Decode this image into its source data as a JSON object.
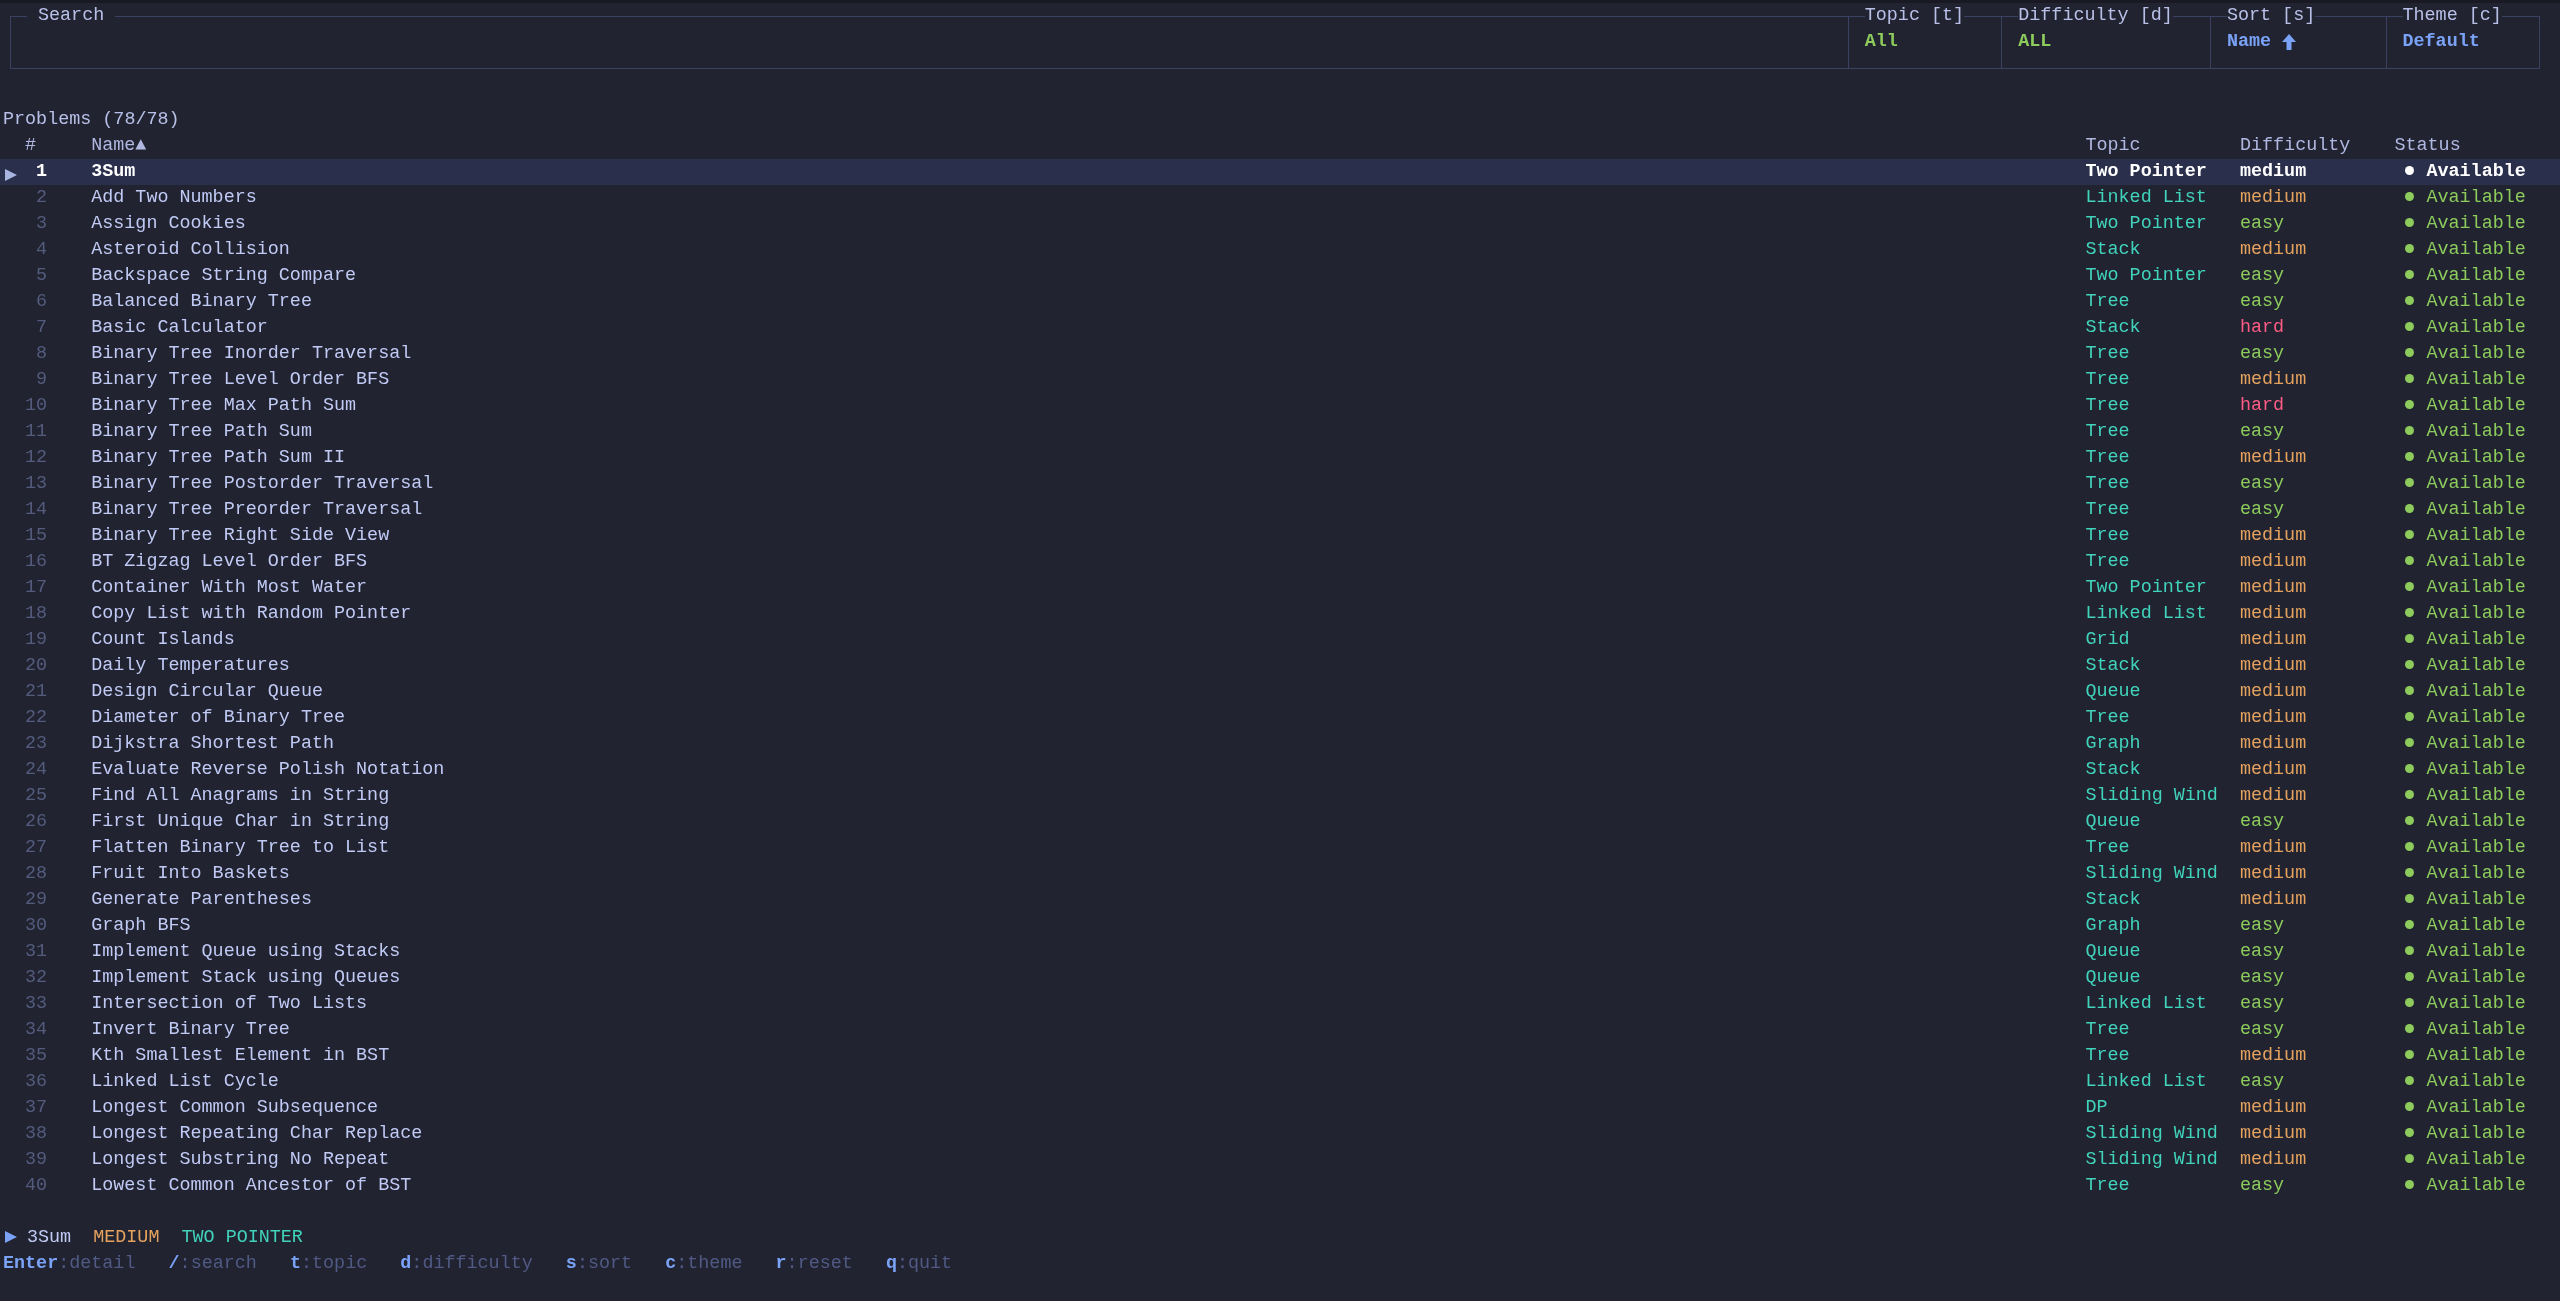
{
  "search": {
    "label": "Search"
  },
  "filters": [
    {
      "label": "Topic [t]",
      "value": "All",
      "kind": "filter"
    },
    {
      "label": "Difficulty [d]",
      "value": "ALL",
      "kind": "filter"
    },
    {
      "label": "Sort [s]",
      "value": "Name",
      "kind": "sort",
      "ascending": true
    },
    {
      "label": "Theme [c]",
      "value": "Default",
      "kind": "theme"
    }
  ],
  "problems": {
    "title": "Problems (78/78)",
    "columns": [
      "#",
      "Name▲",
      "Topic",
      "Difficulty",
      "Status"
    ],
    "rows": [
      {
        "number": "1",
        "name": "3Sum",
        "topic": "Two Pointer",
        "difficulty": {
          "label": "medium",
          "kind": "medium"
        },
        "status": "Available",
        "selected": true
      },
      {
        "number": "2",
        "name": "Add Two Numbers",
        "topic": "Linked List",
        "difficulty": {
          "label": "medium",
          "kind": "medium"
        },
        "status": "Available",
        "selected": false
      },
      {
        "number": "3",
        "name": "Assign Cookies",
        "topic": "Two Pointer",
        "difficulty": {
          "label": "easy",
          "kind": "easy"
        },
        "status": "Available",
        "selected": false
      },
      {
        "number": "4",
        "name": "Asteroid Collision",
        "topic": "Stack",
        "difficulty": {
          "label": "medium",
          "kind": "medium"
        },
        "status": "Available",
        "selected": false
      },
      {
        "number": "5",
        "name": "Backspace String Compare",
        "topic": "Two Pointer",
        "difficulty": {
          "label": "easy",
          "kind": "easy"
        },
        "status": "Available",
        "selected": false
      },
      {
        "number": "6",
        "name": "Balanced Binary Tree",
        "topic": "Tree",
        "difficulty": {
          "label": "easy",
          "kind": "easy"
        },
        "status": "Available",
        "selected": false
      },
      {
        "number": "7",
        "name": "Basic Calculator",
        "topic": "Stack",
        "difficulty": {
          "label": "hard",
          "kind": "hard"
        },
        "status": "Available",
        "selected": false
      },
      {
        "number": "8",
        "name": "Binary Tree Inorder Traversal",
        "topic": "Tree",
        "difficulty": {
          "label": "easy",
          "kind": "easy"
        },
        "status": "Available",
        "selected": false
      },
      {
        "number": "9",
        "name": "Binary Tree Level Order BFS",
        "topic": "Tree",
        "difficulty": {
          "label": "medium",
          "kind": "medium"
        },
        "status": "Available",
        "selected": false
      },
      {
        "number": "10",
        "name": "Binary Tree Max Path Sum",
        "topic": "Tree",
        "difficulty": {
          "label": "hard",
          "kind": "hard"
        },
        "status": "Available",
        "selected": false
      },
      {
        "number": "11",
        "name": "Binary Tree Path Sum",
        "topic": "Tree",
        "difficulty": {
          "label": "easy",
          "kind": "easy"
        },
        "status": "Available",
        "selected": false
      },
      {
        "number": "12",
        "name": "Binary Tree Path Sum II",
        "topic": "Tree",
        "difficulty": {
          "label": "medium",
          "kind": "medium"
        },
        "status": "Available",
        "selected": false
      },
      {
        "number": "13",
        "name": "Binary Tree Postorder Traversal",
        "topic": "Tree",
        "difficulty": {
          "label": "easy",
          "kind": "easy"
        },
        "status": "Available",
        "selected": false
      },
      {
        "number": "14",
        "name": "Binary Tree Preorder Traversal",
        "topic": "Tree",
        "difficulty": {
          "label": "easy",
          "kind": "easy"
        },
        "status": "Available",
        "selected": false
      },
      {
        "number": "15",
        "name": "Binary Tree Right Side View",
        "topic": "Tree",
        "difficulty": {
          "label": "medium",
          "kind": "medium"
        },
        "status": "Available",
        "selected": false
      },
      {
        "number": "16",
        "name": "BT Zigzag Level Order BFS",
        "topic": "Tree",
        "difficulty": {
          "label": "medium",
          "kind": "medium"
        },
        "status": "Available",
        "selected": false
      },
      {
        "number": "17",
        "name": "Container With Most Water",
        "topic": "Two Pointer",
        "difficulty": {
          "label": "medium",
          "kind": "medium"
        },
        "status": "Available",
        "selected": false
      },
      {
        "number": "18",
        "name": "Copy List with Random Pointer",
        "topic": "Linked List",
        "difficulty": {
          "label": "medium",
          "kind": "medium"
        },
        "status": "Available",
        "selected": false
      },
      {
        "number": "19",
        "name": "Count Islands",
        "topic": "Grid",
        "difficulty": {
          "label": "medium",
          "kind": "medium"
        },
        "status": "Available",
        "selected": false
      },
      {
        "number": "20",
        "name": "Daily Temperatures",
        "topic": "Stack",
        "difficulty": {
          "label": "medium",
          "kind": "medium"
        },
        "status": "Available",
        "selected": false
      },
      {
        "number": "21",
        "name": "Design Circular Queue",
        "topic": "Queue",
        "difficulty": {
          "label": "medium",
          "kind": "medium"
        },
        "status": "Available",
        "selected": false
      },
      {
        "number": "22",
        "name": "Diameter of Binary Tree",
        "topic": "Tree",
        "difficulty": {
          "label": "medium",
          "kind": "medium"
        },
        "status": "Available",
        "selected": false
      },
      {
        "number": "23",
        "name": "Dijkstra Shortest Path",
        "topic": "Graph",
        "difficulty": {
          "label": "medium",
          "kind": "medium"
        },
        "status": "Available",
        "selected": false
      },
      {
        "number": "24",
        "name": "Evaluate Reverse Polish Notation",
        "topic": "Stack",
        "difficulty": {
          "label": "medium",
          "kind": "medium"
        },
        "status": "Available",
        "selected": false
      },
      {
        "number": "25",
        "name": "Find All Anagrams in String",
        "topic": "Sliding Wind",
        "difficulty": {
          "label": "medium",
          "kind": "medium"
        },
        "status": "Available",
        "selected": false
      },
      {
        "number": "26",
        "name": "First Unique Char in String",
        "topic": "Queue",
        "difficulty": {
          "label": "easy",
          "kind": "easy"
        },
        "status": "Available",
        "selected": false
      },
      {
        "number": "27",
        "name": "Flatten Binary Tree to List",
        "topic": "Tree",
        "difficulty": {
          "label": "medium",
          "kind": "medium"
        },
        "status": "Available",
        "selected": false
      },
      {
        "number": "28",
        "name": "Fruit Into Baskets",
        "topic": "Sliding Wind",
        "difficulty": {
          "label": "medium",
          "kind": "medium"
        },
        "status": "Available",
        "selected": false
      },
      {
        "number": "29",
        "name": "Generate Parentheses",
        "topic": "Stack",
        "difficulty": {
          "label": "medium",
          "kind": "medium"
        },
        "status": "Available",
        "selected": false
      },
      {
        "number": "30",
        "name": "Graph BFS",
        "topic": "Graph",
        "difficulty": {
          "label": "easy",
          "kind": "easy"
        },
        "status": "Available",
        "selected": false
      },
      {
        "number": "31",
        "name": "Implement Queue using Stacks",
        "topic": "Queue",
        "difficulty": {
          "label": "easy",
          "kind": "easy"
        },
        "status": "Available",
        "selected": false
      },
      {
        "number": "32",
        "name": "Implement Stack using Queues",
        "topic": "Queue",
        "difficulty": {
          "label": "easy",
          "kind": "easy"
        },
        "status": "Available",
        "selected": false
      },
      {
        "number": "33",
        "name": "Intersection of Two Lists",
        "topic": "Linked List",
        "difficulty": {
          "label": "easy",
          "kind": "easy"
        },
        "status": "Available",
        "selected": false
      },
      {
        "number": "34",
        "name": "Invert Binary Tree",
        "topic": "Tree",
        "difficulty": {
          "label": "easy",
          "kind": "easy"
        },
        "status": "Available",
        "selected": false
      },
      {
        "number": "35",
        "name": "Kth Smallest Element in BST",
        "topic": "Tree",
        "difficulty": {
          "label": "medium",
          "kind": "medium"
        },
        "status": "Available",
        "selected": false
      },
      {
        "number": "36",
        "name": "Linked List Cycle",
        "topic": "Linked List",
        "difficulty": {
          "label": "easy",
          "kind": "easy"
        },
        "status": "Available",
        "selected": false
      },
      {
        "number": "37",
        "name": "Longest Common Subsequence",
        "topic": "DP",
        "difficulty": {
          "label": "medium",
          "kind": "medium"
        },
        "status": "Available",
        "selected": false
      },
      {
        "number": "38",
        "name": "Longest Repeating Char Replace",
        "topic": "Sliding Wind",
        "difficulty": {
          "label": "medium",
          "kind": "medium"
        },
        "status": "Available",
        "selected": false
      },
      {
        "number": "39",
        "name": "Longest Substring No Repeat",
        "topic": "Sliding Wind",
        "difficulty": {
          "label": "medium",
          "kind": "medium"
        },
        "status": "Available",
        "selected": false
      },
      {
        "number": "40",
        "name": "Lowest Common Ancestor of BST",
        "topic": "Tree",
        "difficulty": {
          "label": "easy",
          "kind": "easy"
        },
        "status": "Available",
        "selected": false
      }
    ]
  },
  "summary": {
    "name": "3Sum",
    "difficulty": {
      "label": "MEDIUM",
      "kind": "medium"
    },
    "topic": "TWO POINTER"
  },
  "shortcuts": [
    {
      "key": "Enter",
      "action": ":detail"
    },
    {
      "key": "/",
      "action": ":search"
    },
    {
      "key": "t",
      "action": ":topic"
    },
    {
      "key": "d",
      "action": ":difficulty"
    },
    {
      "key": "s",
      "action": ":sort"
    },
    {
      "key": "c",
      "action": ":theme"
    },
    {
      "key": "r",
      "action": ":reset"
    },
    {
      "key": "q",
      "action": ":quit"
    }
  ]
}
